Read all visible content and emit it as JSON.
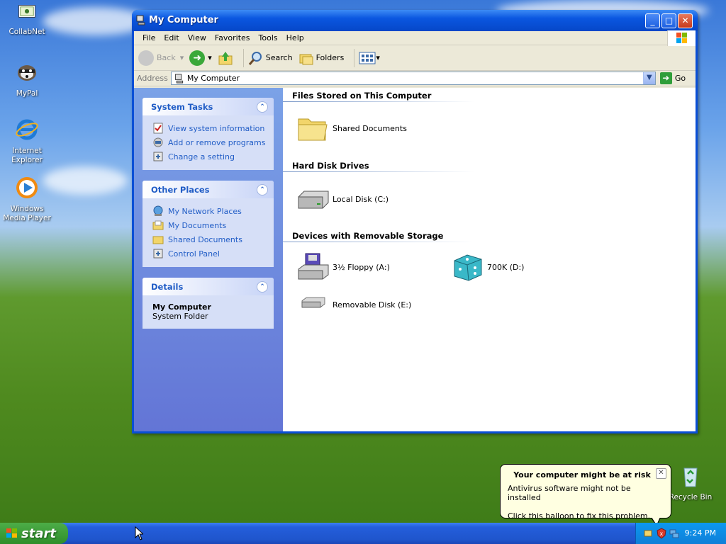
{
  "desktop": {
    "icons": [
      {
        "label": "CollabNet"
      },
      {
        "label": "MyPal"
      },
      {
        "label": "Internet Explorer"
      },
      {
        "label": "Windows Media Player"
      },
      {
        "label": "Recycle Bin"
      }
    ]
  },
  "window": {
    "title": "My Computer",
    "menu": [
      "File",
      "Edit",
      "View",
      "Favorites",
      "Tools",
      "Help"
    ],
    "toolbar": {
      "back": "Back",
      "search": "Search",
      "folders": "Folders"
    },
    "address": {
      "label": "Address",
      "value": "My Computer",
      "go": "Go"
    },
    "tasks": {
      "system_tasks": {
        "title": "System Tasks",
        "items": [
          "View system information",
          "Add or remove programs",
          "Change a setting"
        ]
      },
      "other_places": {
        "title": "Other Places",
        "items": [
          "My Network Places",
          "My Documents",
          "Shared Documents",
          "Control Panel"
        ]
      },
      "details": {
        "title": "Details",
        "name": "My Computer",
        "type": "System Folder"
      }
    },
    "groups": {
      "files": {
        "title": "Files Stored on This Computer",
        "items": [
          "Shared Documents"
        ]
      },
      "hdd": {
        "title": "Hard Disk Drives",
        "items": [
          "Local Disk (C:)"
        ]
      },
      "removable": {
        "title": "Devices with Removable Storage",
        "items": [
          "3½ Floppy (A:)",
          "700K (D:)",
          "Removable Disk (E:)"
        ]
      }
    }
  },
  "taskbar": {
    "start": "start",
    "clock": "9:24 PM"
  },
  "balloon": {
    "title": "Your computer might be at risk",
    "line1": "Antivirus software might not be installed",
    "line2": "Click this balloon to fix this problem."
  },
  "colors": {
    "title_blue": "#0a56e0",
    "task_link": "#215dc6",
    "start_green": "#3a9a34"
  }
}
